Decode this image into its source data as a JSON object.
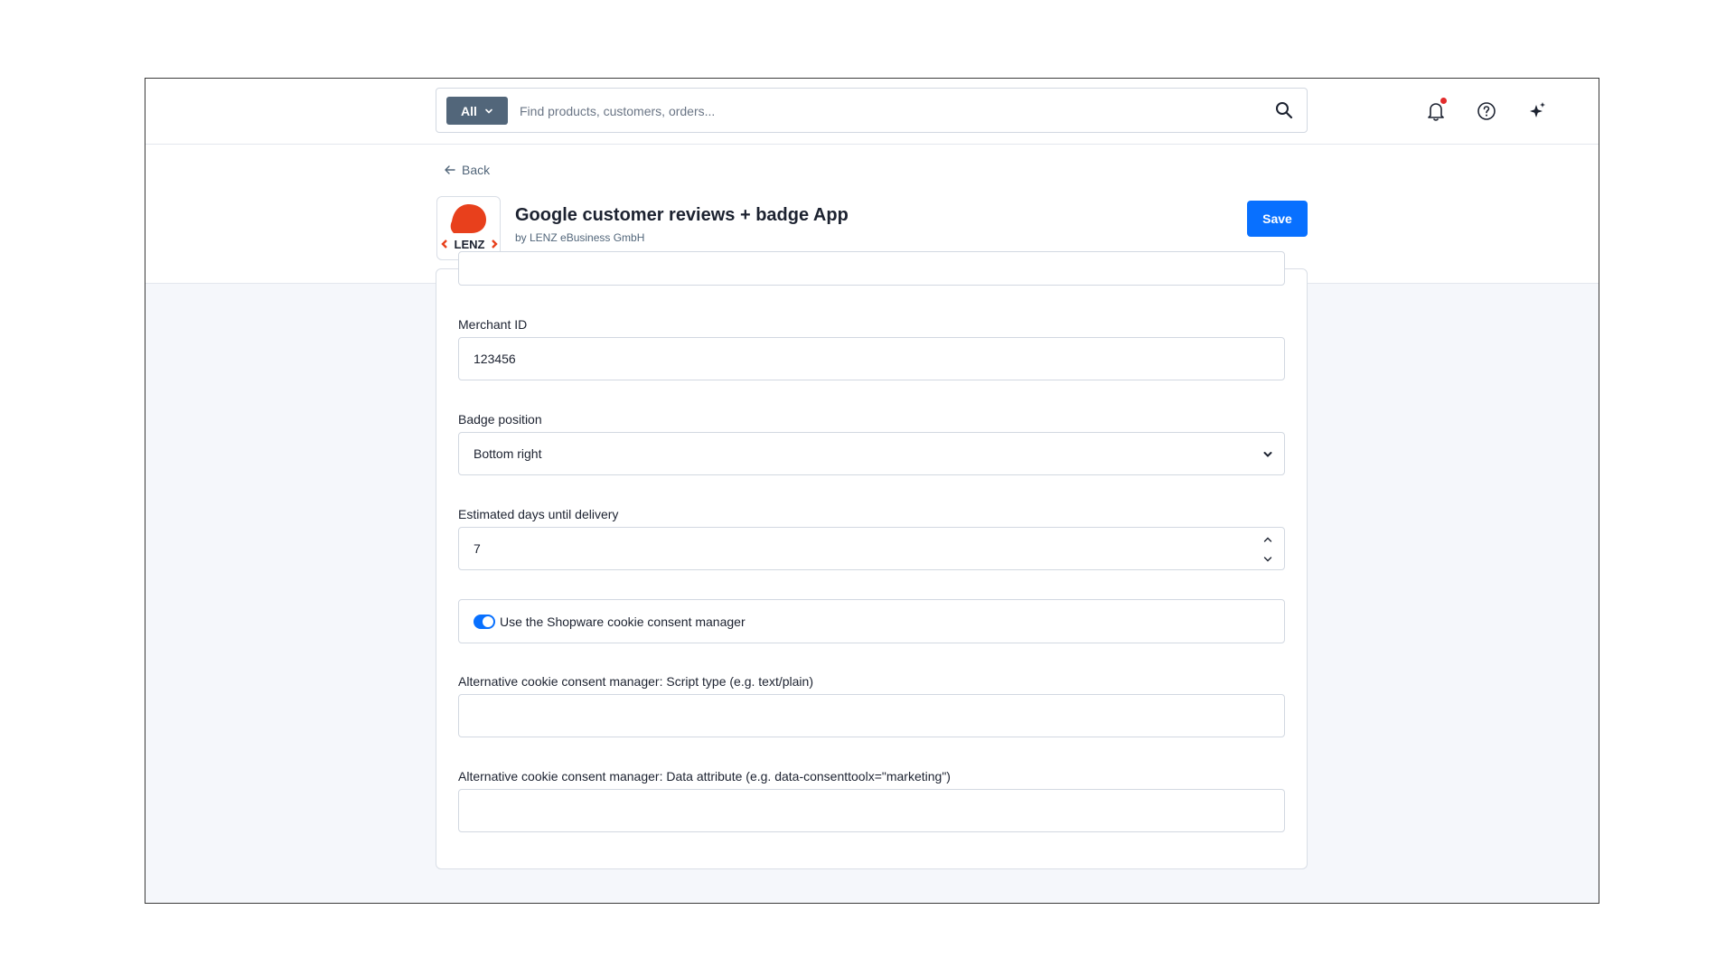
{
  "search": {
    "scope_label": "All",
    "placeholder": "Find products, customers, orders..."
  },
  "topbar": {
    "icons": [
      "bell-icon",
      "help-icon",
      "sparkle-icon"
    ],
    "notification_dot_color": "#e22c2c"
  },
  "header": {
    "back_label": "Back",
    "app_title": "Google customer reviews + badge App",
    "app_vendor": "by LENZ eBusiness GmbH",
    "logo_text": "‹LENZ›",
    "save_label": "Save"
  },
  "form": {
    "merchant_id": {
      "label": "Merchant ID",
      "value": "123456"
    },
    "badge_position": {
      "label": "Badge position",
      "value": "Bottom right"
    },
    "delivery_days": {
      "label": "Estimated days until delivery",
      "value": "7"
    },
    "cookie_toggle": {
      "label": "Use the Shopware cookie consent manager",
      "checked": true
    },
    "script_type": {
      "label": "Alternative cookie consent manager: Script type (e.g. text/plain)",
      "value": ""
    },
    "data_attribute": {
      "label": "Alternative cookie consent manager: Data attribute (e.g. data-consenttoolx=\"marketing\")",
      "value": ""
    }
  },
  "colors": {
    "primary": "#0870ff",
    "scope_bg": "#52667a",
    "logo_red": "#e8401c"
  }
}
